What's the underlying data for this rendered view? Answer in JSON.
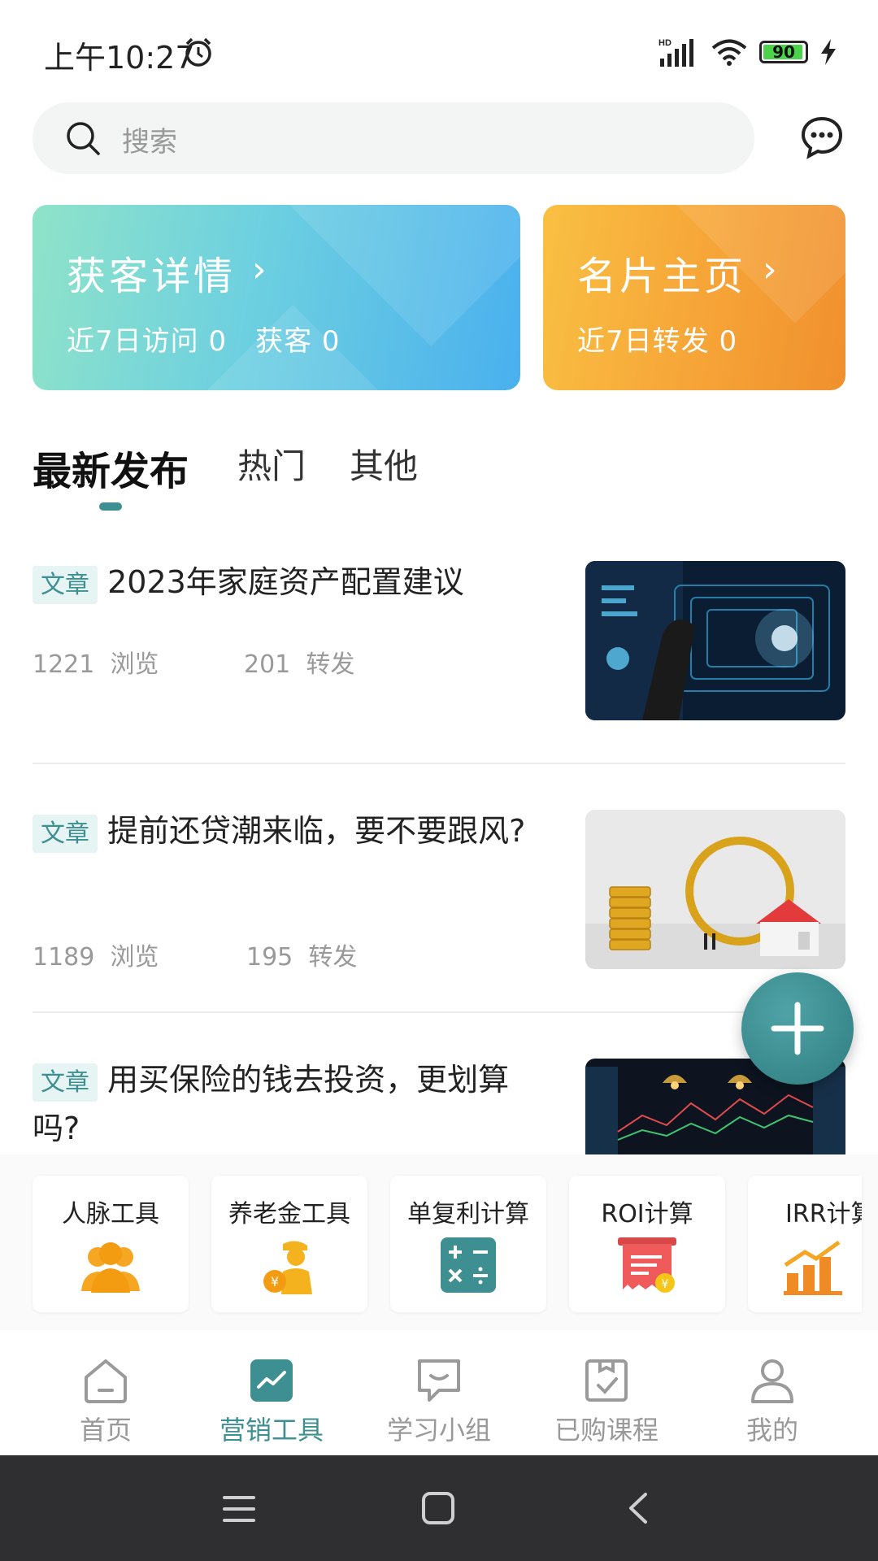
{
  "status": {
    "time": "上午10:27",
    "network": "HD",
    "battery": "90"
  },
  "search": {
    "placeholder": "搜索"
  },
  "cards": [
    {
      "title": "获客详情",
      "arrow": "›",
      "stats": "近7日访问 0　获客 0"
    },
    {
      "title": "名片主页",
      "arrow": "›",
      "stats": "近7日转发 0"
    }
  ],
  "tabs": [
    {
      "label": "最新发布",
      "active": true
    },
    {
      "label": "热门",
      "active": false
    },
    {
      "label": "其他",
      "active": false
    }
  ],
  "articles": [
    {
      "tag": "文章",
      "title": "2023年家庭资产配置建议",
      "views": "1221",
      "views_label": "浏览",
      "shares": "201",
      "shares_label": "转发"
    },
    {
      "tag": "文章",
      "title": "提前还贷潮来临，要不要跟风?",
      "views": "1189",
      "views_label": "浏览",
      "shares": "195",
      "shares_label": "转发"
    },
    {
      "tag": "文章",
      "title": "用买保险的钱去投资，更划算吗?",
      "views": "",
      "views_label": "",
      "shares": "",
      "shares_label": ""
    }
  ],
  "tools": [
    {
      "label": "人脉工具",
      "icon": "people-icon",
      "color": "#f5a623"
    },
    {
      "label": "养老金工具",
      "icon": "pension-icon",
      "color": "#f5b21f"
    },
    {
      "label": "单复利计算",
      "icon": "calculator-icon",
      "color": "#3e8f91"
    },
    {
      "label": "ROI计算",
      "icon": "receipt-icon",
      "color": "#ef5b5b"
    },
    {
      "label": "IRR计算",
      "icon": "bar-chart-icon",
      "color": "#f08a24"
    }
  ],
  "nav": [
    {
      "label": "首页",
      "active": false
    },
    {
      "label": "营销工具",
      "active": true
    },
    {
      "label": "学习小组",
      "active": false
    },
    {
      "label": "已购课程",
      "active": false
    },
    {
      "label": "我的",
      "active": false
    }
  ],
  "colors": {
    "accent": "#3e8f91",
    "card_left": "#4ab0ee",
    "card_right": "#f6a437"
  }
}
